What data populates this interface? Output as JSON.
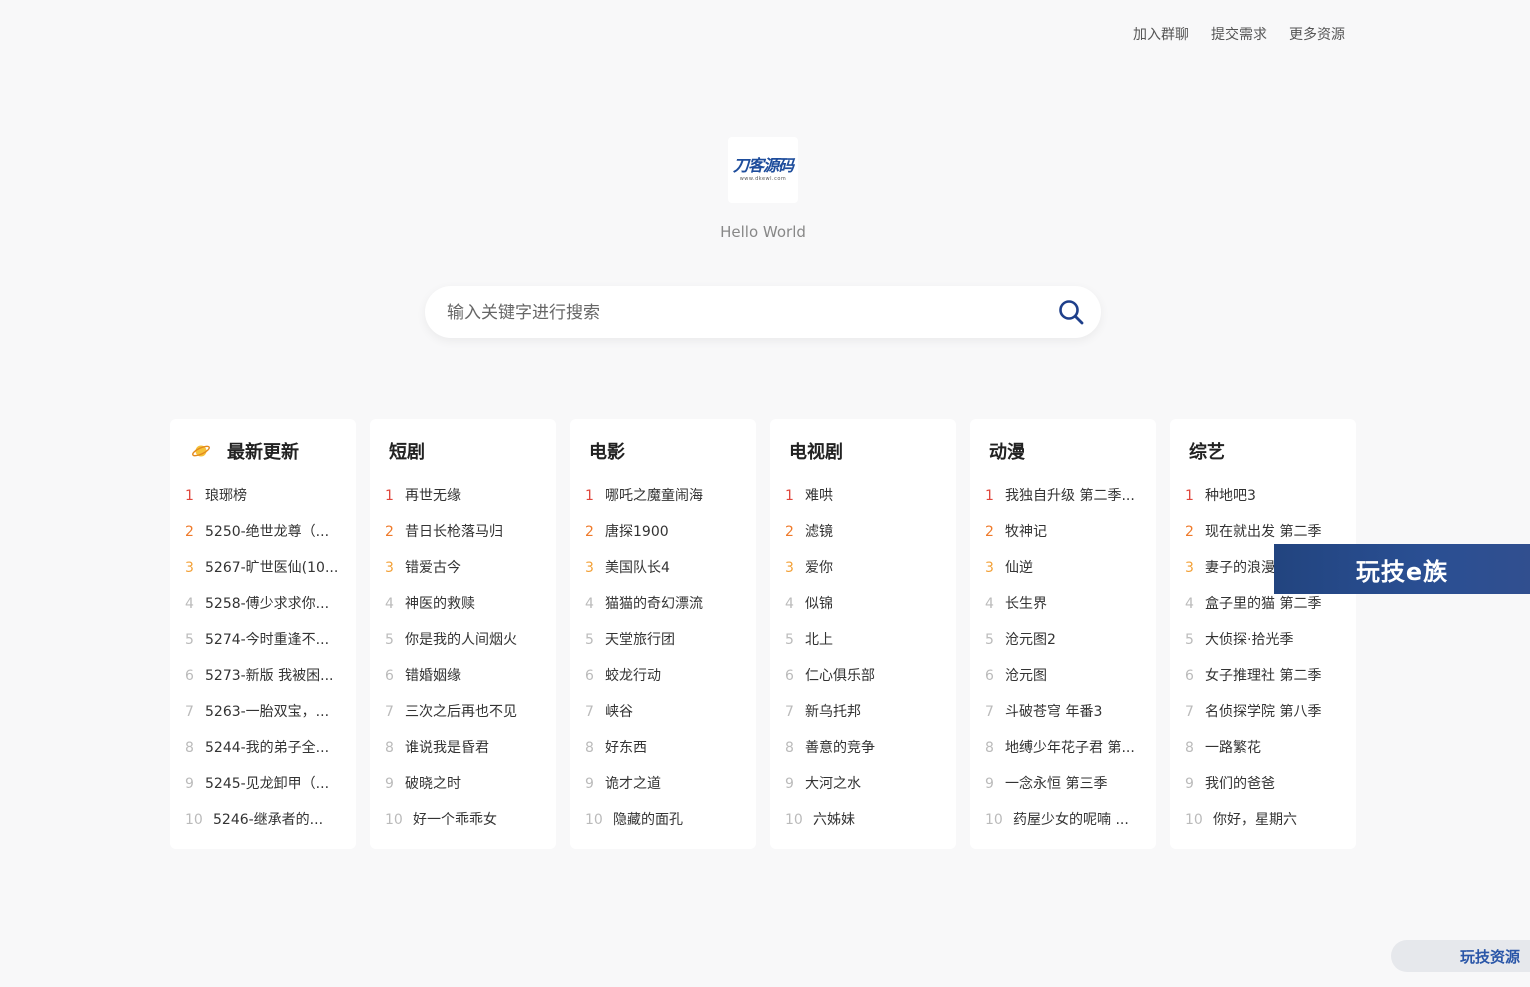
{
  "topnav": [
    {
      "label": "加入群聊"
    },
    {
      "label": "提交需求"
    },
    {
      "label": "更多资源"
    }
  ],
  "logo": {
    "main": "刀客源码",
    "sub": "www.dkewl.com"
  },
  "tagline": "Hello World",
  "search": {
    "placeholder": "输入关键字进行搜索",
    "value": ""
  },
  "cards": [
    {
      "title": "最新更新",
      "items": [
        "琅琊榜",
        "5250-绝世龙尊（...",
        "5267-旷世医仙(10...",
        "5258-傅少求求你...",
        "5274-今时重逢不...",
        "5273-新版 我被困...",
        "5263-一胎双宝，...",
        "5244-我的弟子全...",
        "5245-见龙卸甲（...",
        "5246-继承者的..."
      ]
    },
    {
      "title": "短剧",
      "items": [
        "再世无缘",
        "昔日长枪落马归",
        "错爱古今",
        "神医的救赎",
        "你是我的人间烟火",
        "错婚姻缘",
        "三次之后再也不见",
        "谁说我是昏君",
        "破晓之时",
        "好一个乖乖女"
      ]
    },
    {
      "title": "电影",
      "items": [
        "哪吒之魔童闹海",
        "唐探1900",
        "美国队长4",
        "猫猫的奇幻漂流",
        "天堂旅行团",
        "蛟龙行动",
        "峡谷",
        "好东西",
        "诡才之道",
        "隐藏的面孔"
      ]
    },
    {
      "title": "电视剧",
      "items": [
        "难哄",
        "滤镜",
        "爱你",
        "似锦",
        "北上",
        "仁心俱乐部",
        "新乌托邦",
        "善意的竞争",
        "大河之水",
        "六姊妹"
      ]
    },
    {
      "title": "动漫",
      "items": [
        "我独自升级 第二季...",
        "牧神记",
        "仙逆",
        "长生界",
        "沧元图2",
        "沧元图",
        "斗破苍穹 年番3",
        "地缚少年花子君 第...",
        "一念永恒 第三季",
        "药屋少女的呢喃 ..."
      ]
    },
    {
      "title": "综艺",
      "items": [
        "种地吧3",
        "现在就出发 第二季",
        "妻子的浪漫",
        "盒子里的猫 第二季",
        "大侦探·拾光季",
        "女子推理社 第二季",
        "名侦探学院 第八季",
        "一路繁花",
        "我们的爸爸",
        "你好，星期六"
      ]
    }
  ],
  "overlays": {
    "banner": "玩技e族",
    "corner": "玩技资源"
  },
  "colors": {
    "rank1": "#e0473c",
    "rank2": "#ef7a2a",
    "rank3": "#f3a23a",
    "accent": "#1e4d9c"
  }
}
